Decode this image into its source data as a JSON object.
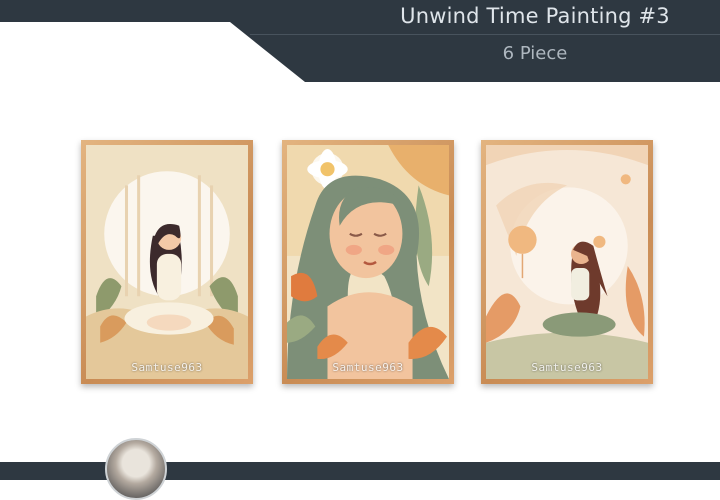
{
  "header": {
    "title": "Unwind Time Painting #3",
    "subtitle": "6 Piece"
  },
  "paintings": [
    {
      "watermark": "Samtuse963",
      "subject": "woman-meditating-seated"
    },
    {
      "watermark": "Samtuse963",
      "subject": "woman-portrait-eyes-closed"
    },
    {
      "watermark": "Samtuse963",
      "subject": "woman-sitting-cross-legged"
    }
  ],
  "colors": {
    "header_bg": "#2e3841",
    "title_text": "#dfe5ea",
    "subtitle_text": "#aeb7bf",
    "frame": "#d9a06a",
    "page_bg": "#ffffff"
  },
  "footer": {
    "avatar_icon": "creator-avatar"
  }
}
